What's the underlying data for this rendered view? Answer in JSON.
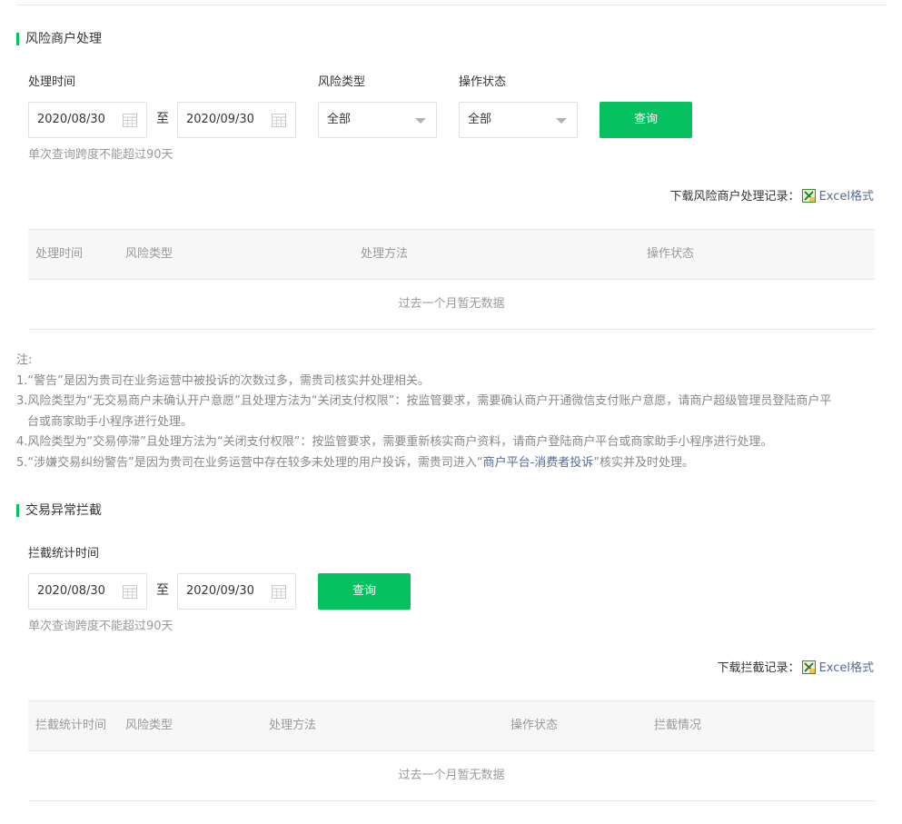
{
  "section1": {
    "title": "风险商户处理",
    "time_label": "处理时间",
    "start_date": "2020/08/30",
    "to_label": "至",
    "end_date": "2020/09/30",
    "risk_type_label": "风险类型",
    "risk_type_value": "全部",
    "op_status_label": "操作状态",
    "op_status_value": "全部",
    "query_button": "查询",
    "hint": "单次查询跨度不能超过90天",
    "download_label": "下载风险商户处理记录：",
    "download_link": "Excel格式",
    "table": {
      "headers": [
        "处理时间",
        "风险类型",
        "处理方法",
        "操作状态"
      ],
      "empty_text": "过去一个月暂无数据"
    }
  },
  "notes": {
    "title": "注:",
    "n1": "1.“警告”是因为贵司在业务运营中被投诉的次数过多，需贵司核实并处理相关。",
    "n3a": "3.风险类型为“无交易商户未确认开户意愿”且处理方法为“关闭支付权限”：按监管要求，需要确认商户开通微信支付账户意愿，请商户超级管理员登陆商户平",
    "n3b": "台或商家助手小程序进行处理。",
    "n4": "4.风险类型为“交易停滞”且处理方法为“关闭支付权限”：按监管要求，需要重新核实商户资料，请商户登陆商户平台或商家助手小程序进行处理。",
    "n5_pre": "5.“涉嫌交易纠纷警告”是因为贵司在业务运营中存在较多未处理的用户投诉，需贵司进入“",
    "n5_link": "商户平台-消费者投诉",
    "n5_post": "”核实并及时处理。"
  },
  "section2": {
    "title": "交易异常拦截",
    "time_label": "拦截统计时间",
    "start_date": "2020/08/30",
    "to_label": "至",
    "end_date": "2020/09/30",
    "query_button": "查询",
    "hint": "单次查询跨度不能超过90天",
    "download_label": "下载拦截记录：",
    "download_link": "Excel格式",
    "table": {
      "headers": [
        "拦截统计时间",
        "风险类型",
        "处理方法",
        "操作状态",
        "拦截情况"
      ],
      "empty_text": "过去一个月暂无数据"
    }
  },
  "colors": {
    "accent": "#07c160",
    "link": "#576b95",
    "muted": "#9a9a9a"
  },
  "icons": {
    "calendar": "calendar-icon",
    "dropdown": "chevron-down-icon",
    "excel": "excel-icon"
  }
}
